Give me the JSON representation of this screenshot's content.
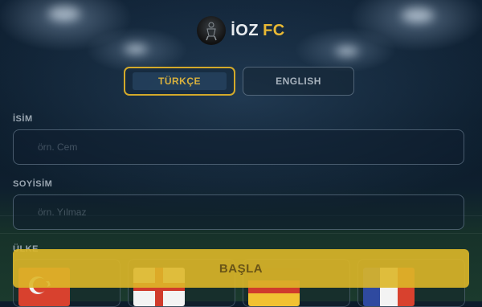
{
  "brand": {
    "name": "İOZ",
    "suffix": "FC",
    "accent": "#e9b934"
  },
  "language": {
    "options": [
      "TÜRKÇE",
      "ENGLISH"
    ],
    "selected": "TÜRKÇE"
  },
  "form": {
    "first_name": {
      "label": "İSİM",
      "placeholder": "örn. Cem"
    },
    "last_name": {
      "label": "SOYİSİM",
      "placeholder": "örn. Yılmaz"
    },
    "country": {
      "label": "ÜLKE"
    }
  },
  "flags": [
    "turkey-flag-icon",
    "england-flag-icon",
    "germany-flag-icon",
    "france-flag-icon"
  ],
  "start_button": "BAŞLA",
  "colors": {
    "gold": "#d3a92a",
    "background": "#0d1c2b"
  }
}
